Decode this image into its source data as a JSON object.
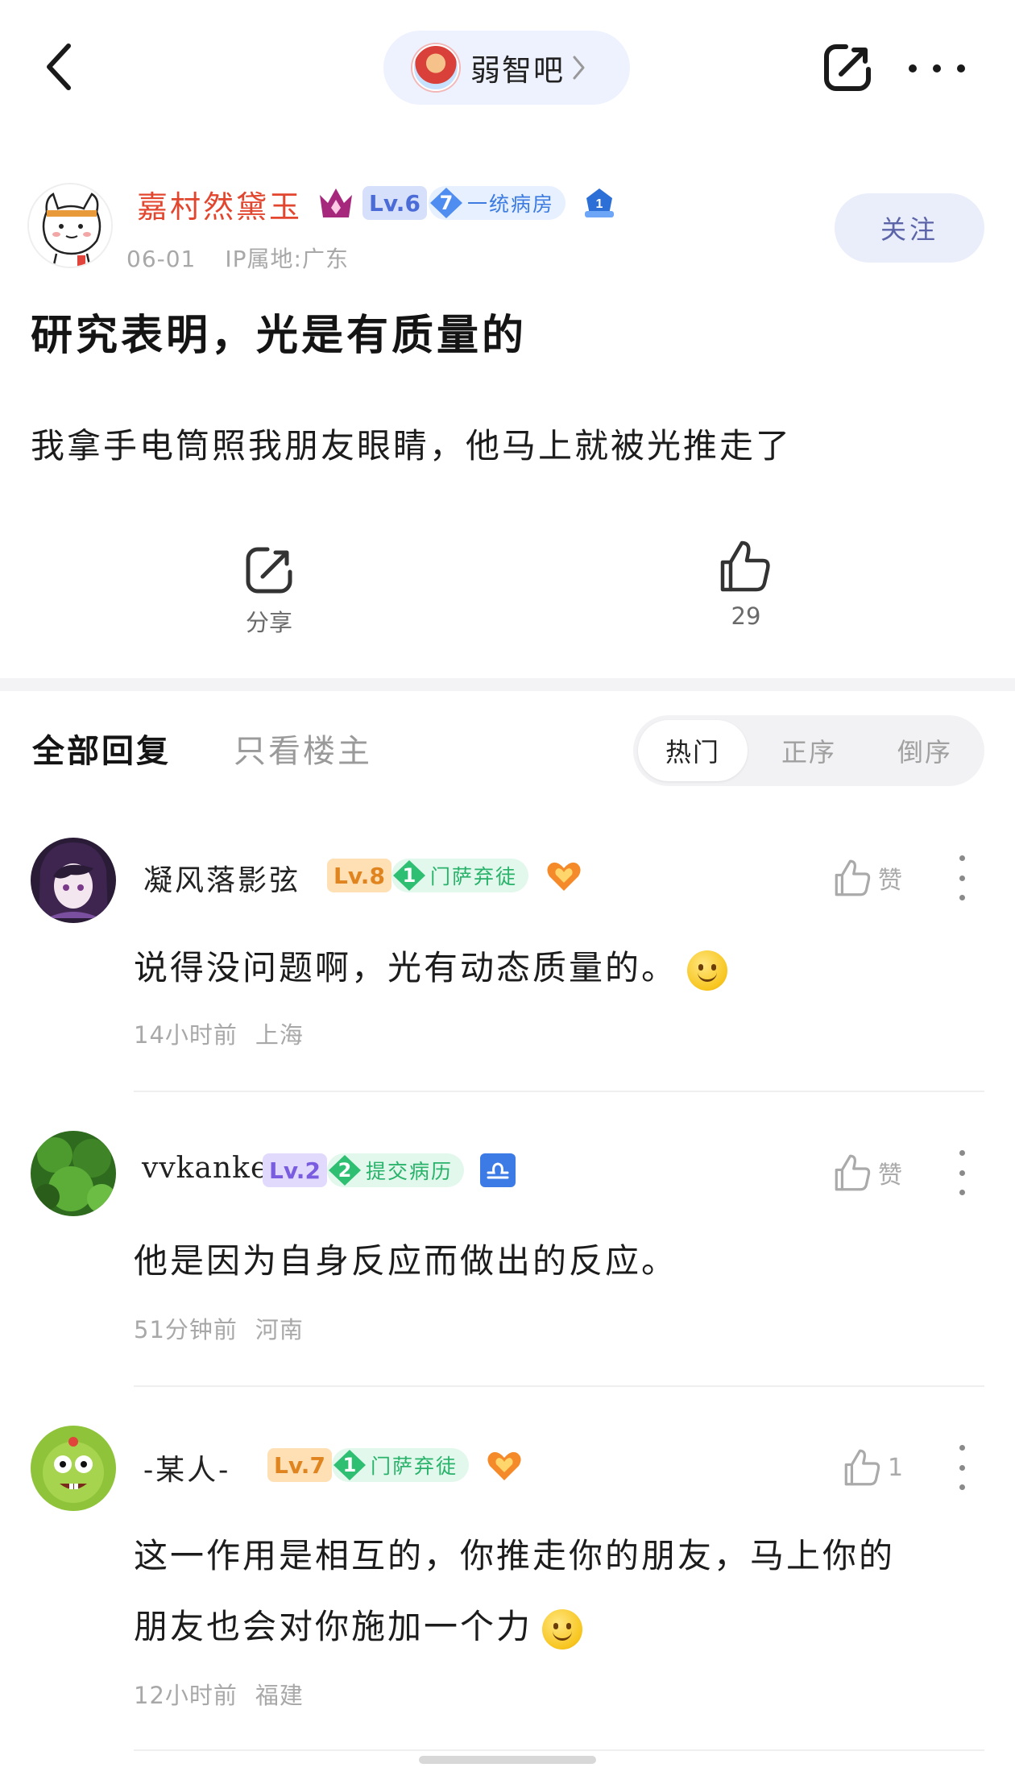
{
  "header": {
    "forum_name": "弱智吧"
  },
  "post": {
    "author": {
      "name": "嘉村然黛玉",
      "level": "Lv.6",
      "honor_num": "7",
      "honor_title": "一统病房",
      "rank_num": "1",
      "date": "06-01",
      "ip": "IP属地:广东"
    },
    "follow_label": "关注",
    "title": "研究表明，光是有质量的",
    "body": "我拿手电筒照我朋友眼睛，他马上就被光推走了",
    "share_label": "分享",
    "like_count": "29"
  },
  "tabs": {
    "all": "全部回复",
    "op_only": "只看楼主",
    "sort": [
      "热门",
      "正序",
      "倒序"
    ],
    "sort_active": "热门"
  },
  "comments": [
    {
      "name": "凝风落影弦",
      "level": "Lv.8",
      "honor_num": "1",
      "honor_title": "门萨弃徒",
      "text": "说得没问题啊，光有动态质量的。",
      "time": "14小时前",
      "location": "上海",
      "like_label": "赞"
    },
    {
      "name": "vvkanke",
      "level": "Lv.2",
      "honor_num": "2",
      "honor_title": "提交病历",
      "text": "他是因为自身反应而做出的反应。",
      "time": "51分钟前",
      "location": "河南",
      "like_label": "赞"
    },
    {
      "name": "-某人-",
      "level": "Lv.7",
      "honor_num": "1",
      "honor_title": "门萨弃徒",
      "text_line1": "这一作用是相互的，你推走你的朋友，马上你的",
      "text_line2": "朋友也会对你施加一个力",
      "time": "12小时前",
      "location": "福建",
      "like_label": "1"
    }
  ],
  "colors": {
    "author_name": "#e2462e",
    "accent_blue": "#4b6bd6",
    "honor_green": "#29b26a",
    "level_orange": "#e0841f"
  }
}
